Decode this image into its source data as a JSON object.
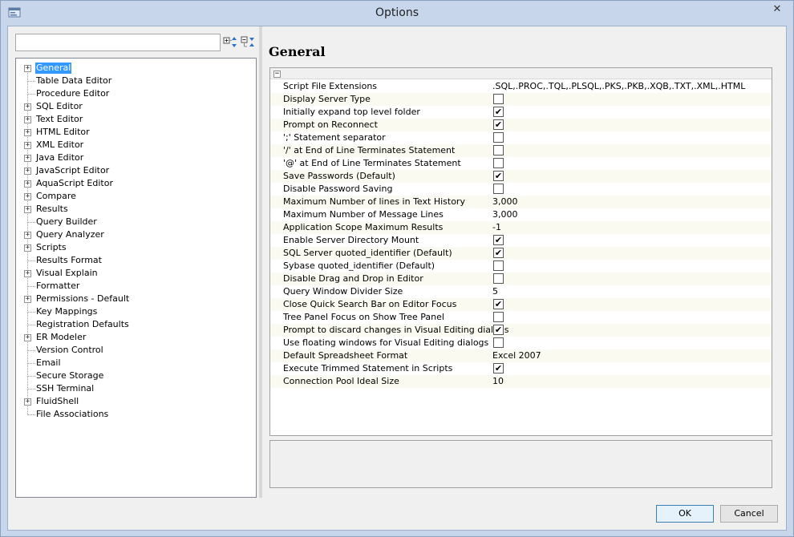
{
  "window": {
    "title": "Options"
  },
  "search": {
    "placeholder": ""
  },
  "tree": {
    "items": [
      {
        "label": "General",
        "expandable": true,
        "selected": true
      },
      {
        "label": "Table Data Editor",
        "expandable": false
      },
      {
        "label": "Procedure Editor",
        "expandable": false
      },
      {
        "label": "SQL Editor",
        "expandable": true
      },
      {
        "label": "Text Editor",
        "expandable": true
      },
      {
        "label": "HTML Editor",
        "expandable": true
      },
      {
        "label": "XML Editor",
        "expandable": true
      },
      {
        "label": "Java Editor",
        "expandable": true
      },
      {
        "label": "JavaScript Editor",
        "expandable": true
      },
      {
        "label": "AquaScript Editor",
        "expandable": true
      },
      {
        "label": "Compare",
        "expandable": true
      },
      {
        "label": "Results",
        "expandable": true
      },
      {
        "label": "Query Builder",
        "expandable": false
      },
      {
        "label": "Query Analyzer",
        "expandable": true
      },
      {
        "label": "Scripts",
        "expandable": true
      },
      {
        "label": "Results Format",
        "expandable": false
      },
      {
        "label": "Visual Explain",
        "expandable": true
      },
      {
        "label": "Formatter",
        "expandable": false
      },
      {
        "label": "Permissions - Default",
        "expandable": true
      },
      {
        "label": "Key Mappings",
        "expandable": false
      },
      {
        "label": "Registration Defaults",
        "expandable": false
      },
      {
        "label": "ER Modeler",
        "expandable": true
      },
      {
        "label": "Version Control",
        "expandable": false
      },
      {
        "label": "Email",
        "expandable": false
      },
      {
        "label": "Secure Storage",
        "expandable": false
      },
      {
        "label": "SSH Terminal",
        "expandable": false
      },
      {
        "label": "FluidShell",
        "expandable": true
      },
      {
        "label": "File Associations",
        "expandable": false
      }
    ]
  },
  "main": {
    "title": "General",
    "properties": [
      {
        "name": "Script File Extensions",
        "type": "text",
        "value": ".SQL,.PROC,.TQL,.PLSQL,.PKS,.PKB,.XQB,.TXT,.XML,.HTML"
      },
      {
        "name": "Display Server Type",
        "type": "check",
        "checked": false
      },
      {
        "name": "Initially expand top level folder",
        "type": "check",
        "checked": true
      },
      {
        "name": "Prompt on Reconnect",
        "type": "check",
        "checked": true
      },
      {
        "name": "';' Statement separator",
        "type": "check",
        "checked": false
      },
      {
        "name": "'/' at End of Line Terminates Statement",
        "type": "check",
        "checked": false
      },
      {
        "name": "'@' at End of Line Terminates Statement",
        "type": "check",
        "checked": false
      },
      {
        "name": "Save Passwords (Default)",
        "type": "check",
        "checked": true
      },
      {
        "name": "Disable Password Saving",
        "type": "check",
        "checked": false
      },
      {
        "name": "Maximum Number of lines in Text History",
        "type": "text",
        "value": "3,000"
      },
      {
        "name": "Maximum Number of Message Lines",
        "type": "text",
        "value": "3,000"
      },
      {
        "name": "Application Scope Maximum Results",
        "type": "text",
        "value": "-1"
      },
      {
        "name": "Enable Server Directory Mount",
        "type": "check",
        "checked": true
      },
      {
        "name": "SQL Server quoted_identifier (Default)",
        "type": "check",
        "checked": true
      },
      {
        "name": "Sybase quoted_identifier (Default)",
        "type": "check",
        "checked": false
      },
      {
        "name": "Disable Drag and Drop in Editor",
        "type": "check",
        "checked": false
      },
      {
        "name": "Query Window Divider Size",
        "type": "text",
        "value": "5"
      },
      {
        "name": "Close Quick Search Bar on Editor Focus",
        "type": "check",
        "checked": true
      },
      {
        "name": "Tree Panel Focus on Show Tree Panel",
        "type": "check",
        "checked": false
      },
      {
        "name": "Prompt to discard changes in Visual Editing dialogs",
        "type": "check",
        "checked": true
      },
      {
        "name": "Use floating windows for Visual Editing dialogs",
        "type": "check",
        "checked": false
      },
      {
        "name": "Default Spreadsheet Format",
        "type": "text",
        "value": "Excel 2007"
      },
      {
        "name": "Execute Trimmed Statement in Scripts",
        "type": "check",
        "checked": true
      },
      {
        "name": "Connection Pool Ideal Size",
        "type": "text",
        "value": "10"
      }
    ]
  },
  "buttons": {
    "ok": "OK",
    "cancel": "Cancel"
  },
  "colors": {
    "selection": "#3399ff",
    "titlebar": "#c7d6ea"
  },
  "icons": {
    "app": "app-window-icon",
    "expand_all": "expand-all-icon",
    "collapse_all": "collapse-all-icon",
    "close": "close-icon"
  }
}
